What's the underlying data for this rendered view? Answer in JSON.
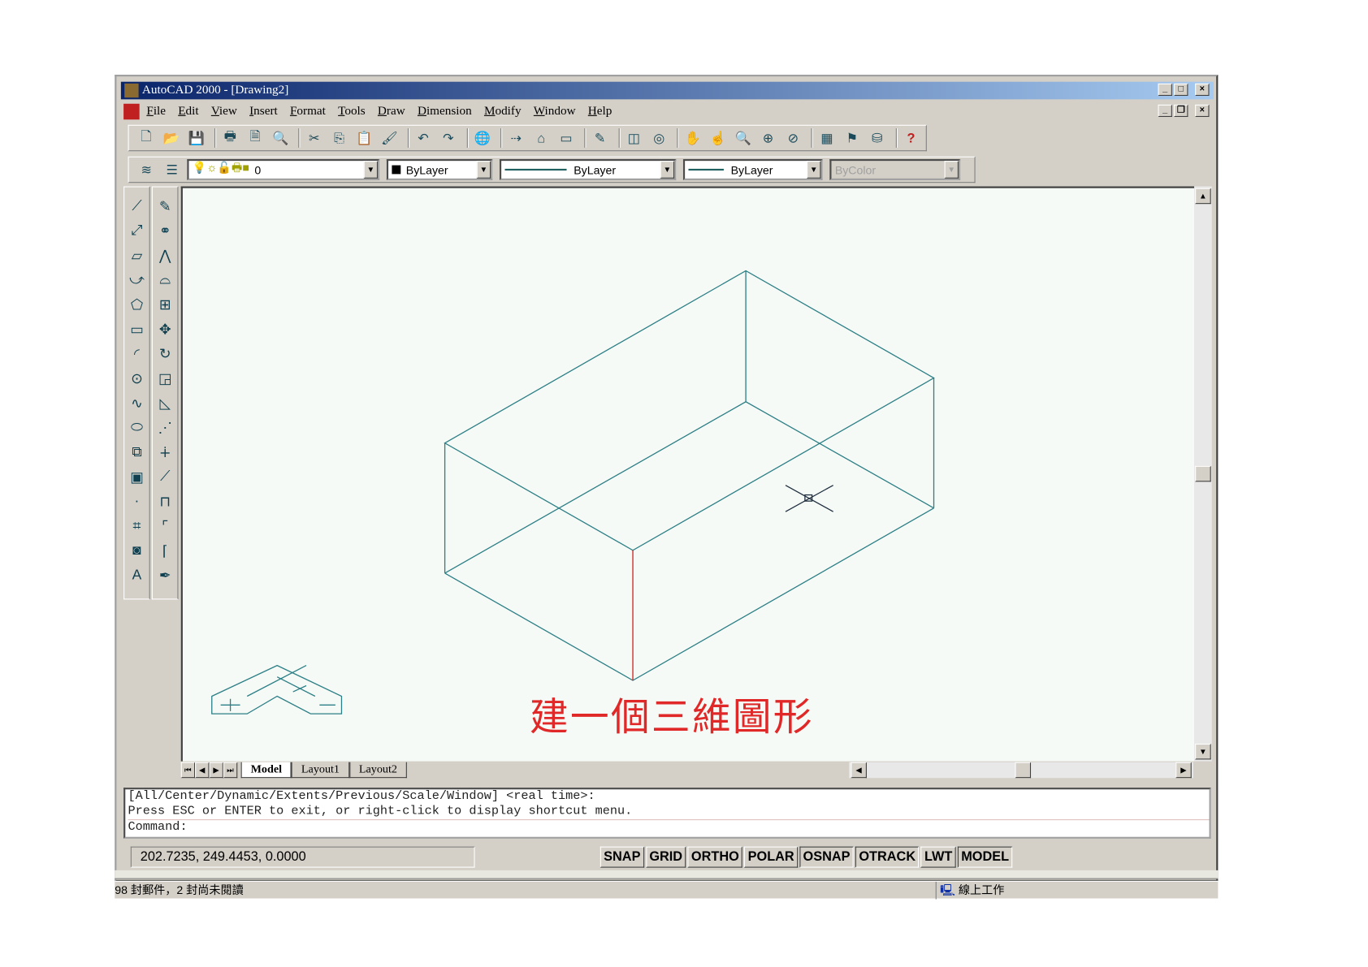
{
  "window": {
    "title": "AutoCAD 2000 - [Drawing2]",
    "controls": [
      "_",
      "□",
      "×"
    ],
    "doc_controls": [
      "_",
      "❐",
      "×"
    ]
  },
  "menu": [
    "File",
    "Edit",
    "View",
    "Insert",
    "Format",
    "Tools",
    "Draw",
    "Dimension",
    "Modify",
    "Window",
    "Help"
  ],
  "properties": {
    "layer": "0",
    "color": "ByLayer",
    "linetype": "ByLayer",
    "lineweight": "ByLayer",
    "plotstyle": "ByColor"
  },
  "drawing": {
    "annotation": "建一個三維圖形",
    "colors": {
      "edge": "#2c7f86",
      "front_edge": "#d02020",
      "annotation": "#e02828"
    }
  },
  "tabs": [
    "Model",
    "Layout1",
    "Layout2"
  ],
  "command": {
    "lines": [
      "[All/Center/Dynamic/Extents/Previous/Scale/Window] <real time>:",
      "Press ESC or ENTER to exit, or right-click to display shortcut menu.",
      "Command:"
    ]
  },
  "status": {
    "coords": "202.7235, 249.4453, 0.0000",
    "buttons": [
      {
        "label": "SNAP",
        "on": false
      },
      {
        "label": "GRID",
        "on": false
      },
      {
        "label": "ORTHO",
        "on": false
      },
      {
        "label": "POLAR",
        "on": false
      },
      {
        "label": "OSNAP",
        "on": true
      },
      {
        "label": "OTRACK",
        "on": true
      },
      {
        "label": "LWT",
        "on": false
      },
      {
        "label": "MODEL",
        "on": true
      }
    ]
  },
  "outlook": {
    "mail": "98 封郵件，2 封尚未閱讀",
    "online": "線上工作"
  }
}
